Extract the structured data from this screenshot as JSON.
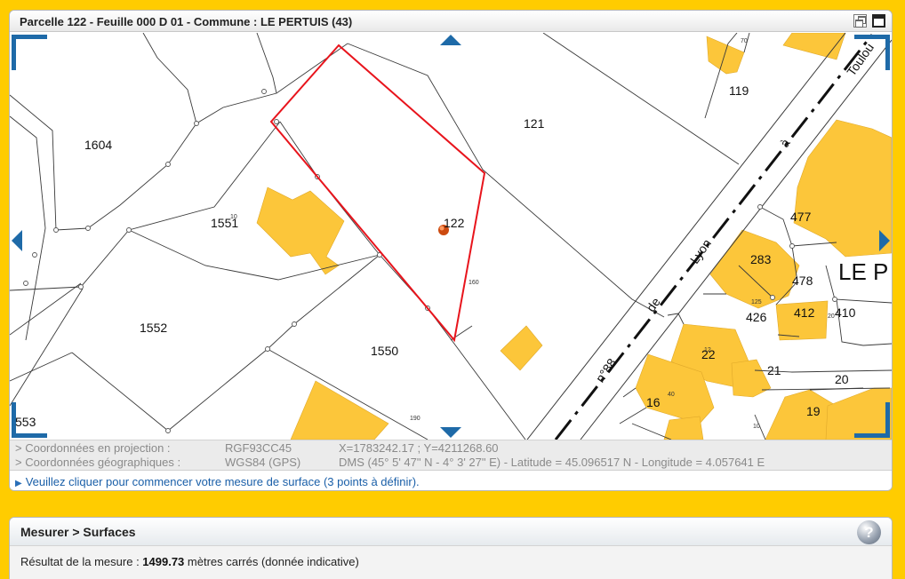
{
  "window": {
    "title": "Parcelle 122 - Feuille 000 D 01 - Commune : LE PERTUIS (43)",
    "restore_icon": "restore-icon",
    "maximize_icon": "maximize-icon"
  },
  "map": {
    "parcels": [
      "1604",
      "121",
      "119",
      "1551",
      "122",
      "477",
      "283",
      "478",
      "1552",
      "426",
      "412",
      "410",
      "1550",
      "22",
      "21",
      "20",
      "16",
      "19",
      "553"
    ],
    "small_labels": [
      "70",
      "160",
      "125",
      "190",
      "40",
      "10",
      "20",
      "12",
      "10"
    ],
    "road_words": [
      "n°88",
      "de",
      "Lyon",
      "à",
      "Toulou"
    ],
    "town_label": "LE P",
    "nav": [
      "pan-up-arrow",
      "pan-down-arrow",
      "pan-left-arrow",
      "pan-right-arrow"
    ],
    "colors": {
      "building": "#fcc63a",
      "parcel_highlight": "#e8141c",
      "nav": "#1e6aa8"
    }
  },
  "coords": {
    "projection_label": "> Coordonnées en projection :",
    "projection_system": "RGF93CC45",
    "projection_value": "X=1783242.17 ; Y=4211268.60",
    "geo_label": "> Coordonnées géographiques :",
    "geo_system": "WGS84 (GPS)",
    "geo_value": "DMS (45° 5' 47\" N - 4° 3' 27\" E) - Latitude = 45.096517 N - Longitude = 4.057641 E"
  },
  "status": {
    "message": "Veuillez cliquer pour commencer votre mesure de surface (3 points à définir)."
  },
  "measure": {
    "title": "Mesurer > Surfaces",
    "result_prefix": "Résultat de la mesure : ",
    "result_value": "1499.73",
    "result_suffix": " mètres carrés (donnée indicative)",
    "help_icon": "help-icon"
  }
}
